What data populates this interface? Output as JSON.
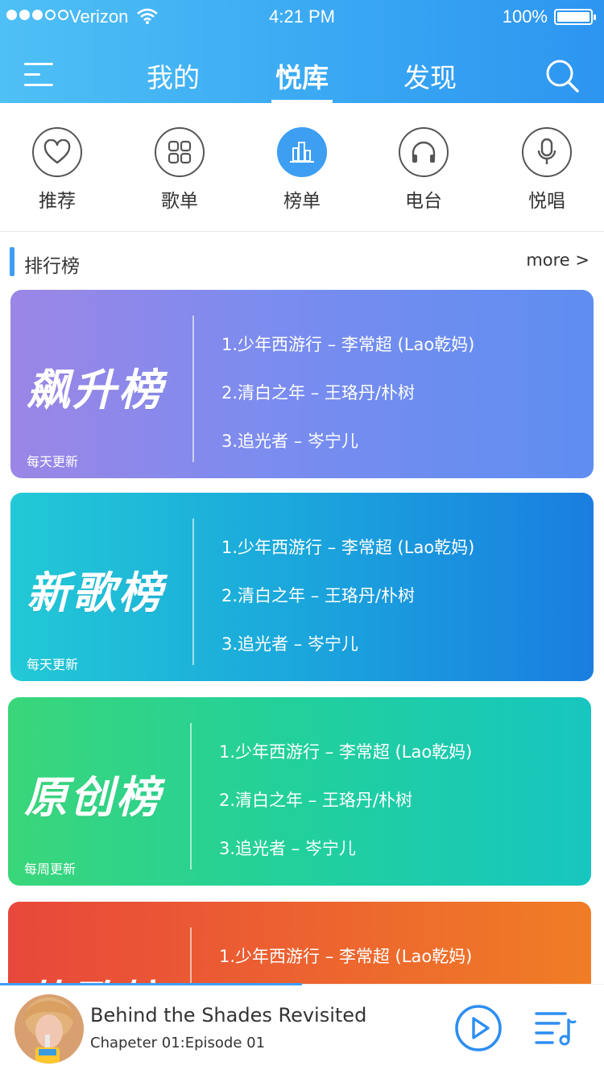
{
  "status_bar": {
    "carrier": "Verizon",
    "time": "4:21 PM",
    "battery": "100%"
  },
  "header": {
    "tabs": [
      {
        "label": "我的"
      },
      {
        "label": "悦库"
      },
      {
        "label": "发现"
      }
    ],
    "active_tab": "悦库"
  },
  "categories": [
    {
      "label": "推荐",
      "icon": "heart-icon"
    },
    {
      "label": "歌单",
      "icon": "grid-icon"
    },
    {
      "label": "榜单",
      "icon": "bar-chart-icon"
    },
    {
      "label": "电台",
      "icon": "headphones-icon"
    },
    {
      "label": "悦唱",
      "icon": "microphone-icon"
    }
  ],
  "section": {
    "title": "排行榜",
    "more": "more >"
  },
  "charts": [
    {
      "title": "飙升榜",
      "update": "每天更新",
      "songs": [
        "1.少年西游行 – 李常超 (Lao乾妈)",
        "2.清白之年 – 王珞丹/朴树",
        "3.追光者 – 岑宁儿"
      ]
    },
    {
      "title": "新歌榜",
      "update": "每天更新",
      "songs": [
        "1.少年西游行 – 李常超 (Lao乾妈)",
        "2.清白之年 – 王珞丹/朴树",
        "3.追光者 – 岑宁儿"
      ]
    },
    {
      "title": "原创榜",
      "update": "每周更新",
      "songs": [
        "1.少年西游行 – 李常超 (Lao乾妈)",
        "2.清白之年 – 王珞丹/朴树",
        "3.追光者 – 岑宁儿"
      ]
    },
    {
      "title": "热歌榜",
      "songs": [
        "1.少年西游行 – 李常超 (Lao乾妈)"
      ]
    }
  ],
  "player": {
    "title": "Behind the Shades Revisited",
    "subtitle": "Chapeter 01:Episode 01",
    "progress": 0.5
  },
  "colors": {
    "accent": "#3d9ef2",
    "card1": [
      "#9b86e6",
      "#5e8ef0"
    ],
    "card2": [
      "#22c9d6",
      "#1a7ee0"
    ],
    "card3": [
      "#3ad67a",
      "#17c6c0"
    ],
    "card4": [
      "#e8483b",
      "#f07d25"
    ]
  }
}
